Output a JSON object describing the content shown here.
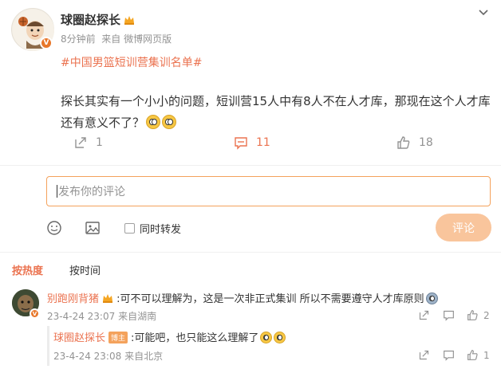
{
  "post": {
    "author": "球圈赵探长",
    "time": "8分钟前",
    "source": "来自 微博网页版",
    "topic": "#中国男篮短训营集训名单#",
    "text": "探长其实有一个小小的问题，短训营15人中有8人不在人才库，那现在这个人才库还有意义不了？",
    "repost_count": "1",
    "comment_count": "11",
    "like_count": "18",
    "verified_badge": "V"
  },
  "composer": {
    "placeholder": "发布你的评论",
    "repost_label": "同时转发",
    "submit_label": "评论"
  },
  "sort": {
    "hot": "按热度",
    "time": "按时间"
  },
  "comments": [
    {
      "author": "别跑刚背猪",
      "text": ":可不可以理解为，这是一次非正式集训 所以不需要遵守人才库原则",
      "time": "23-4-24 23:07",
      "location": "来自湖南",
      "like_count": "2",
      "reply": {
        "author": "球圈赵探长",
        "badge": "博主",
        "text": ":可能吧，也只能这么理解了",
        "time": "23-4-24 23:08",
        "location": "来自北京",
        "like_count": "1"
      }
    }
  ],
  "colors": {
    "accent": "#eb7350",
    "focus_border": "#f4a25c",
    "button_disabled": "#f9c59c",
    "muted_text": "#939393"
  },
  "icons": [
    "chevron-down-icon",
    "repost-icon",
    "comment-icon",
    "like-icon",
    "emoji-picker-icon",
    "image-icon",
    "crown-icon"
  ]
}
